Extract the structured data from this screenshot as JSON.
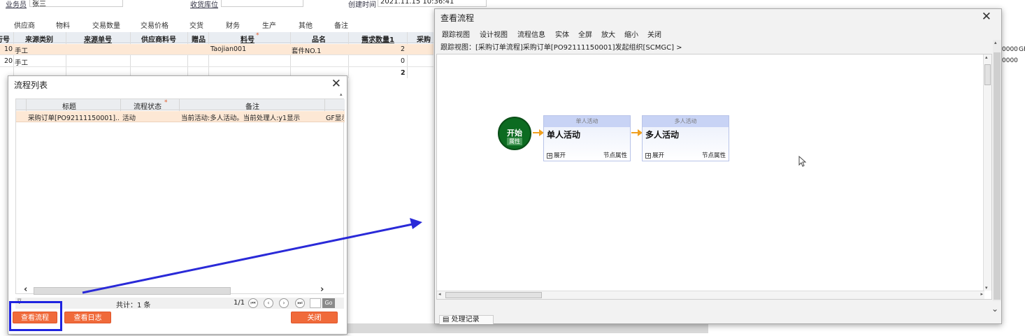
{
  "background": {
    "fields": [
      {
        "label": "业务员",
        "value": "张三"
      },
      {
        "label": "收货库位",
        "value": ""
      },
      {
        "label": "创建时间",
        "value": "2021.11.15 10:36:41"
      }
    ],
    "tabs": [
      "供应商",
      "物料",
      "交易数量",
      "交易价格",
      "交货",
      "财务",
      "生产",
      "其他",
      "备注"
    ],
    "grid": {
      "headers": [
        "行号",
        "来源类别",
        "来源单号",
        "供应商料号",
        "赠品",
        "料号",
        "品名",
        "需求数量1",
        "采购数"
      ],
      "rows": [
        {
          "no": "10",
          "src_type": "手工",
          "item": "Taojian001",
          "name": "套件NO.1",
          "qty": "2"
        },
        {
          "no": "20",
          "src_type": "手工",
          "item": "",
          "name": "",
          "qty": "0"
        }
      ],
      "total_qty": "2",
      "right_values": [
        "0000",
        "0000"
      ],
      "right_extra": "GF"
    }
  },
  "list_dialog": {
    "title": "流程列表",
    "columns": [
      "标题",
      "流程状态",
      "备注"
    ],
    "rows": [
      {
        "title": "采购订单[PO92111150001]...",
        "status": "活动",
        "note": "当前活动:多人活动。当前处理人:y1显示",
        "extra": "GF显示"
      }
    ],
    "total": "共计：1 条",
    "page": "1/1",
    "go": "Go",
    "buttons": {
      "view_flow": "查看流程",
      "view_log": "查看日志",
      "close": "关闭"
    }
  },
  "flow_dialog": {
    "title": "查看流程",
    "menu": [
      "跟踪视图",
      "设计视图",
      "流程信息",
      "实体",
      "全屏",
      "放大",
      "缩小",
      "关闭"
    ],
    "trail": "跟踪视图：[采购订单流程]采购订单[PO92111150001]发起组织[SCMGC] >",
    "start_node": {
      "label": "开始",
      "attr": "属性"
    },
    "nodes": [
      {
        "header": "单人活动",
        "title": "单人活动",
        "expand": "展开",
        "prop": "节点属性"
      },
      {
        "header": "多人活动",
        "title": "多人活动",
        "expand": "展开",
        "prop": "节点属性"
      }
    ],
    "footer_tab": "处理记录"
  },
  "colors": {
    "accent_orange": "#f06a3a",
    "highlight_blue": "#1f24e0",
    "start_green": "#0c6b21",
    "selected_row": "#fde8d5"
  }
}
